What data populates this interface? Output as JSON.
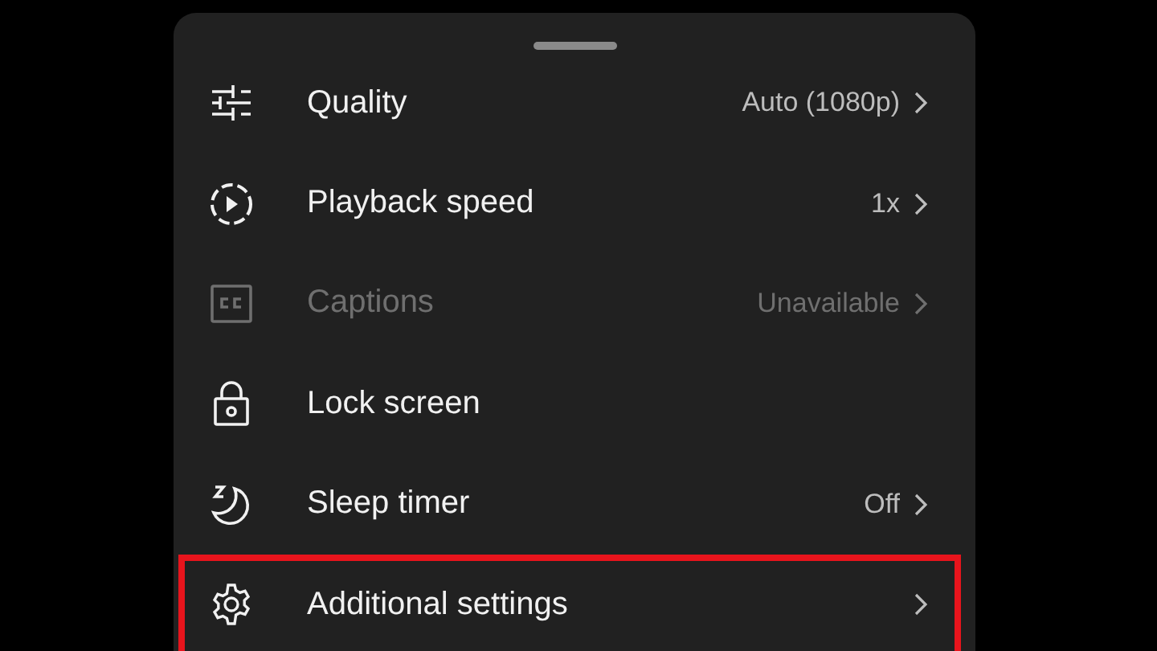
{
  "sheet": {
    "items": [
      {
        "kind": "sliders",
        "label": "Quality",
        "value": "Auto (1080p)",
        "chevron": true,
        "disabled": false,
        "highlighted": false
      },
      {
        "kind": "speed",
        "label": "Playback speed",
        "value": "1x",
        "chevron": true,
        "disabled": false,
        "highlighted": false
      },
      {
        "kind": "captions",
        "label": "Captions",
        "value": "Unavailable",
        "chevron": true,
        "disabled": true,
        "highlighted": false
      },
      {
        "kind": "lock",
        "label": "Lock screen",
        "chevron": false,
        "disabled": false,
        "highlighted": false
      },
      {
        "kind": "sleep",
        "label": "Sleep timer",
        "value": "Off",
        "chevron": true,
        "disabled": false,
        "highlighted": false
      },
      {
        "kind": "gear",
        "label": "Additional settings",
        "chevron": true,
        "disabled": false,
        "highlighted": true
      }
    ]
  }
}
